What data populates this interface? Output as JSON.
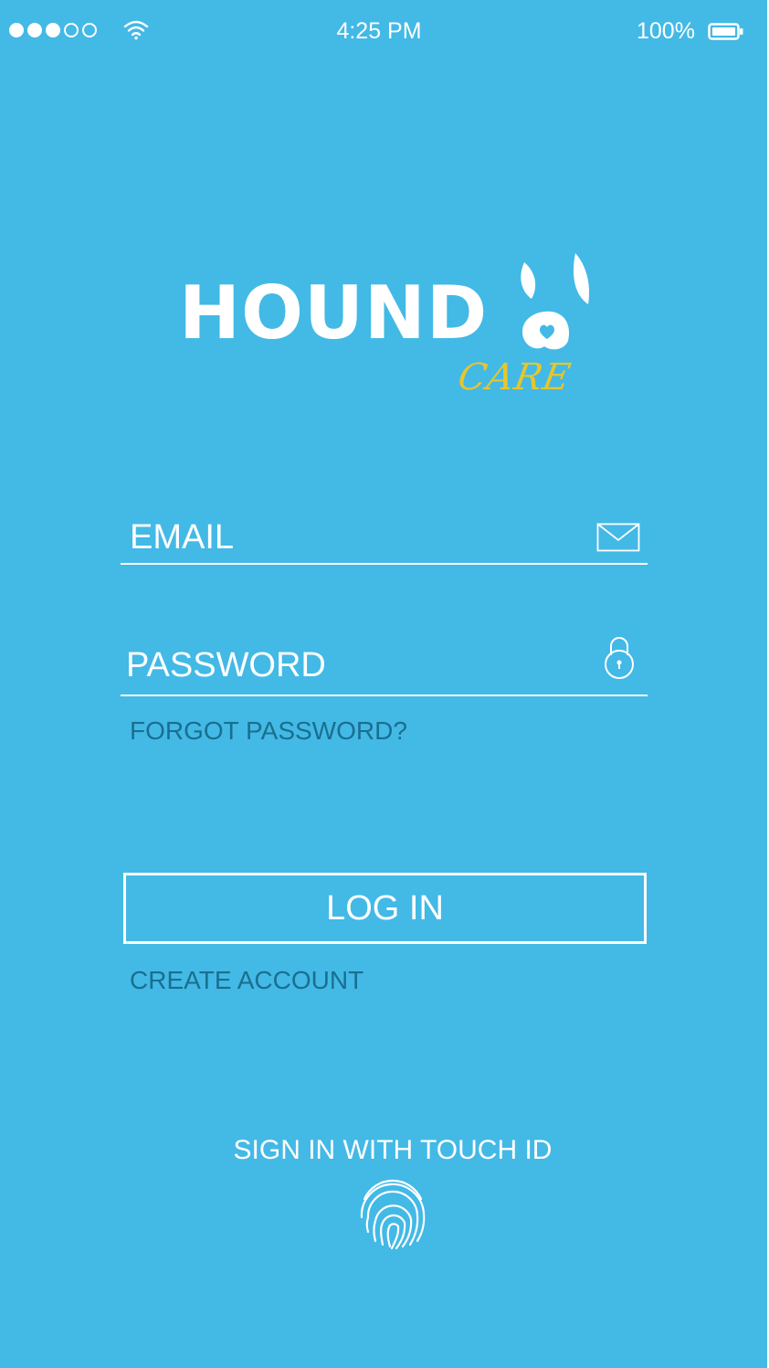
{
  "status_bar": {
    "time": "4:25 PM",
    "battery": "100%",
    "signal_filled": 3,
    "signal_total": 5,
    "icons": [
      "signal-dots-icon",
      "wifi-icon",
      "battery-icon"
    ]
  },
  "logo": {
    "wordmark": "HOUND",
    "sub": "CARE",
    "icon": "dog-ears-heart-icon"
  },
  "form": {
    "email_placeholder": "EMAIL",
    "email_value": "",
    "email_icon": "mail-icon",
    "password_placeholder": "PASSWORD",
    "password_value": "",
    "password_icon": "lock-icon",
    "forgot_label": "FORGOT PASSWORD?",
    "login_label": "LOG IN",
    "create_label": "CREATE ACCOUNT"
  },
  "touch_id": {
    "label": "SIGN IN WITH TOUCH ID",
    "icon": "fingerprint-icon"
  },
  "colors": {
    "background": "#43b9e6",
    "link": "#1a6f8f",
    "accent": "#e6c62e",
    "foreground": "#ffffff"
  }
}
